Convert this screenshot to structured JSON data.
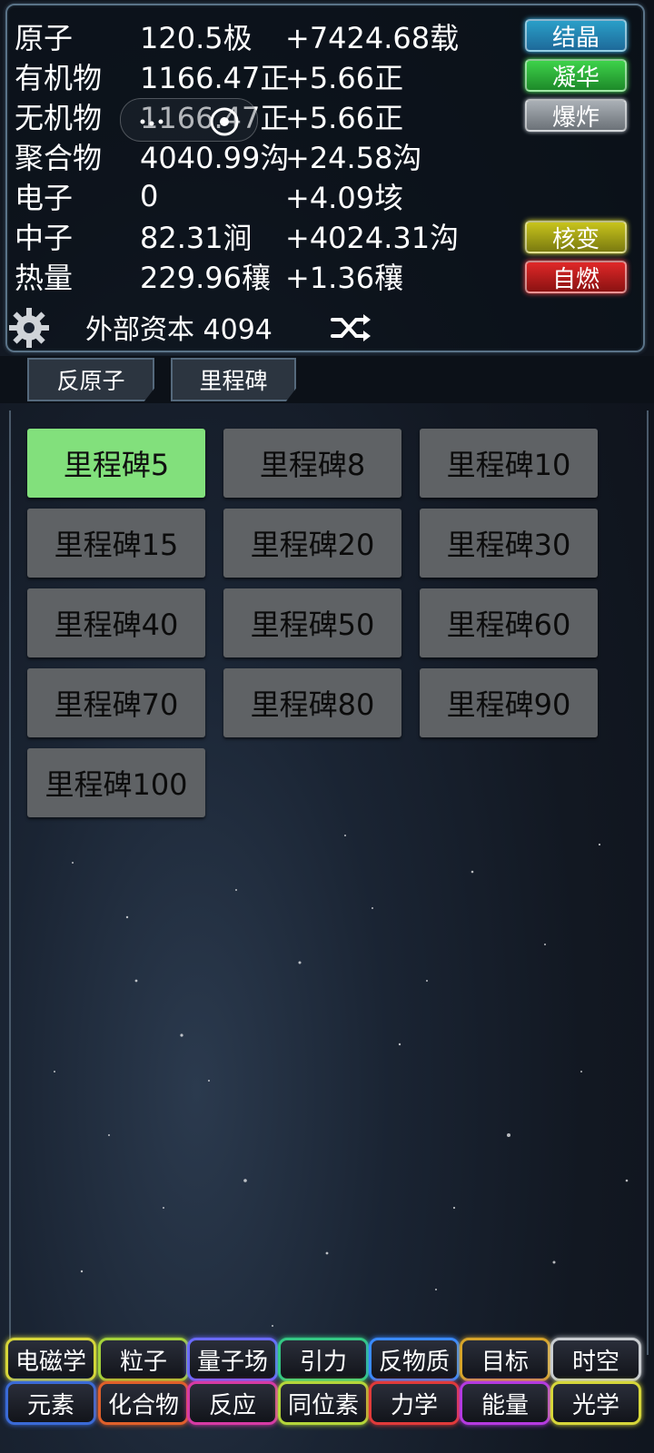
{
  "resources": [
    {
      "name": "原子",
      "value": "120.5极",
      "rate": "+7424.68载"
    },
    {
      "name": "有机物",
      "value": "1166.47正",
      "rate": "+5.66正"
    },
    {
      "name": "无机物",
      "value": "1166.47正",
      "rate": "+5.66正"
    },
    {
      "name": "聚合物",
      "value": "4040.99沟",
      "rate": "+24.58沟"
    },
    {
      "name": "电子",
      "value": "0",
      "rate": "+4.09垓"
    },
    {
      "name": "中子",
      "value": "82.31涧",
      "rate": "+4024.31沟"
    },
    {
      "name": "热量",
      "value": "229.96穰",
      "rate": "+1.36穰"
    }
  ],
  "actions": {
    "crystal": "结晶",
    "sublimate": "凝华",
    "explode": "爆炸",
    "fission": "核变",
    "combust": "自燃"
  },
  "capital": "外部资本 4094",
  "tabs": [
    "反原子",
    "里程碑"
  ],
  "milestones": [
    "里程碑5",
    "里程碑8",
    "里程碑10",
    "里程碑15",
    "里程碑20",
    "里程碑30",
    "里程碑40",
    "里程碑50",
    "里程碑60",
    "里程碑70",
    "里程碑80",
    "里程碑90",
    "里程碑100"
  ],
  "nav_row1": [
    "电磁学",
    "粒子",
    "量子场",
    "引力",
    "反物质",
    "目标",
    "时空"
  ],
  "nav_row2": [
    "元素",
    "化合物",
    "反应",
    "同位素",
    "力学",
    "能量",
    "光学"
  ],
  "colors": {
    "active_milestone": "#82e07c",
    "nav_row1_borders": [
      "#d6d63a",
      "#a4d23a",
      "#6a6aff",
      "#34c884",
      "#3a8aff",
      "#d6a42a",
      "#c8ccd0"
    ],
    "nav_row2_borders": [
      "#3a6ad6",
      "#e0602a",
      "#d63aa4",
      "#b4d63a",
      "#e03a3a",
      "#b43ae0",
      "#d6d63a"
    ]
  },
  "icons": {
    "settings": "gear-icon",
    "shuffle": "shuffle-icon"
  }
}
